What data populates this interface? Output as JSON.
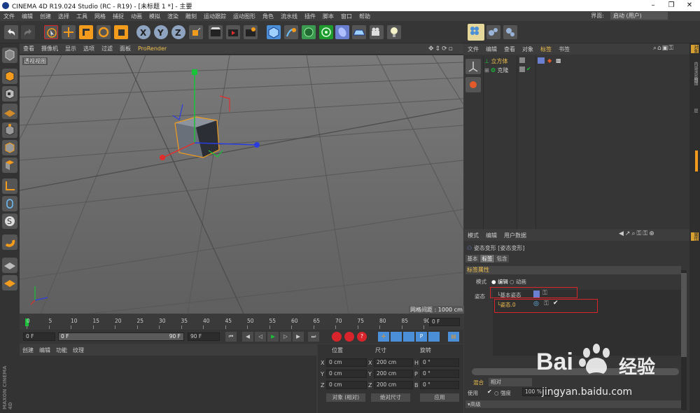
{
  "window": {
    "title": "CINEMA 4D R19.024 Studio (RC - R19) - [未标题 1 *] - 主要",
    "minimize": "–",
    "maximize": "❐",
    "close": "✕"
  },
  "menubar": [
    "文件",
    "编辑",
    "创建",
    "选择",
    "工具",
    "网格",
    "捕捉",
    "动画",
    "模拟",
    "渲染",
    "雕刻",
    "运动跟踪",
    "运动图形",
    "角色",
    "流水线",
    "插件",
    "脚本",
    "窗口",
    "帮助"
  ],
  "layout": {
    "label": "界面:",
    "value": "启动 (用户)"
  },
  "viewport": {
    "menu": [
      "查看",
      "摄像机",
      "显示",
      "选项",
      "过滤",
      "面板",
      "ProRender"
    ],
    "name": "透视视图",
    "grid_info": "网格间距 : 1000 cm"
  },
  "timeline": {
    "ticks": [
      "0",
      "5",
      "10",
      "15",
      "20",
      "25",
      "30",
      "35",
      "40",
      "45",
      "50",
      "55",
      "60",
      "65",
      "70",
      "75",
      "80",
      "85",
      "90"
    ],
    "current_frame": "0 F",
    "start": "0 F",
    "range_start": "0 F",
    "range_end": "90 F",
    "end": "90 F"
  },
  "material_manager": {
    "menu": [
      "创建",
      "编辑",
      "功能",
      "纹理"
    ]
  },
  "coordinates": {
    "headers": {
      "position": "位置",
      "size": "尺寸",
      "rotation": "旋转"
    },
    "rows": [
      {
        "axis": "X",
        "pos": "0 cm",
        "size_axis": "X",
        "size": "200 cm",
        "rot_axis": "H",
        "rot": "0 °"
      },
      {
        "axis": "Y",
        "pos": "0 cm",
        "size_axis": "Y",
        "size": "200 cm",
        "rot_axis": "P",
        "rot": "0 °"
      },
      {
        "axis": "Z",
        "pos": "0 cm",
        "size_axis": "Z",
        "size": "200 cm",
        "rot_axis": "B",
        "rot": "0 °"
      }
    ],
    "mode": "对象 (相对)",
    "size_mode": "绝对尺寸",
    "apply": "应用"
  },
  "object_manager": {
    "menu": [
      "文件",
      "编辑",
      "查看",
      "对象",
      "标签",
      "书签"
    ],
    "objects": [
      {
        "name": "立方体"
      },
      {
        "name": "克隆"
      }
    ]
  },
  "attributes": {
    "menu": [
      "模式",
      "编辑",
      "用户数据"
    ],
    "title": "姿态变形 [姿态变形]",
    "tabs": [
      "基本",
      "标签",
      "包含"
    ],
    "section": "标签属性",
    "mode_label": "模式",
    "mode_edit": "编辑",
    "mode_anim": "动画",
    "pose_label": "姿态",
    "base_pose": "基本姿态",
    "pose0": "姿态.0",
    "blend": "混合",
    "blend_mode": "相对",
    "use": "使用",
    "strength": "强度",
    "strength_val": "100 %",
    "advanced": "▾高级",
    "check": "✔"
  },
  "right_tabs": [
    "对象",
    "内容浏览器",
    "构造",
    "层"
  ],
  "right_tabs2": [
    "属性"
  ],
  "watermark": {
    "brand": "Bai",
    "brand2": "经验",
    "url": "jingyan.baidu.com"
  },
  "colors": {
    "accent_orange": "#f29b1d",
    "highlight_red": "#d8242b",
    "axis_x": "#e22d2d",
    "axis_y": "#19c239",
    "axis_z": "#2b3de0"
  }
}
